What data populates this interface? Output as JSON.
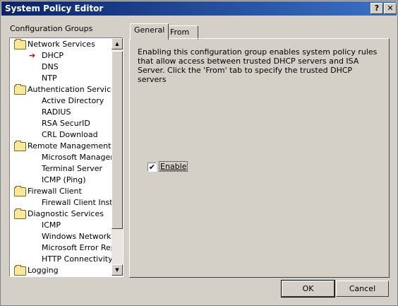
{
  "window": {
    "title": "System Policy Editor",
    "help_label": "?",
    "close_label": "✕"
  },
  "groups": {
    "label": "Configuration Groups",
    "items": [
      {
        "label": "Network Services",
        "type": "folder"
      },
      {
        "label": "DHCP",
        "type": "child",
        "selected": true
      },
      {
        "label": "DNS",
        "type": "child"
      },
      {
        "label": "NTP",
        "type": "child"
      },
      {
        "label": "Authentication Services",
        "type": "folder"
      },
      {
        "label": "Active Directory",
        "type": "child"
      },
      {
        "label": "RADIUS",
        "type": "child"
      },
      {
        "label": "RSA SecurID",
        "type": "child"
      },
      {
        "label": "CRL Download",
        "type": "child"
      },
      {
        "label": "Remote Management",
        "type": "folder"
      },
      {
        "label": "Microsoft Manageme",
        "type": "child"
      },
      {
        "label": "Terminal Server",
        "type": "child"
      },
      {
        "label": "ICMP (Ping)",
        "type": "child"
      },
      {
        "label": "Firewall Client",
        "type": "folder"
      },
      {
        "label": "Firewall Client Install",
        "type": "child"
      },
      {
        "label": "Diagnostic Services",
        "type": "folder"
      },
      {
        "label": "ICMP",
        "type": "child"
      },
      {
        "label": "Windows Networking",
        "type": "child"
      },
      {
        "label": "Microsoft Error Repo",
        "type": "child"
      },
      {
        "label": "HTTP Connectivity ve",
        "type": "child"
      },
      {
        "label": "Logging",
        "type": "folder"
      }
    ]
  },
  "tabs": {
    "general": "General",
    "from": "From"
  },
  "general": {
    "description": "Enabling this configuration group enables system policy rules that allow access between trusted DHCP servers and ISA Server. Click the 'From' tab to specify the trusted DHCP servers",
    "enable_label": "Enable",
    "enable_checked": true
  },
  "buttons": {
    "ok": "OK",
    "cancel": "Cancel"
  },
  "colors": {
    "titlebar_start": "#0a246a",
    "titlebar_end": "#3b72c6",
    "dialog_face": "#d4d0c8",
    "selected_arrow": "#d00000"
  }
}
